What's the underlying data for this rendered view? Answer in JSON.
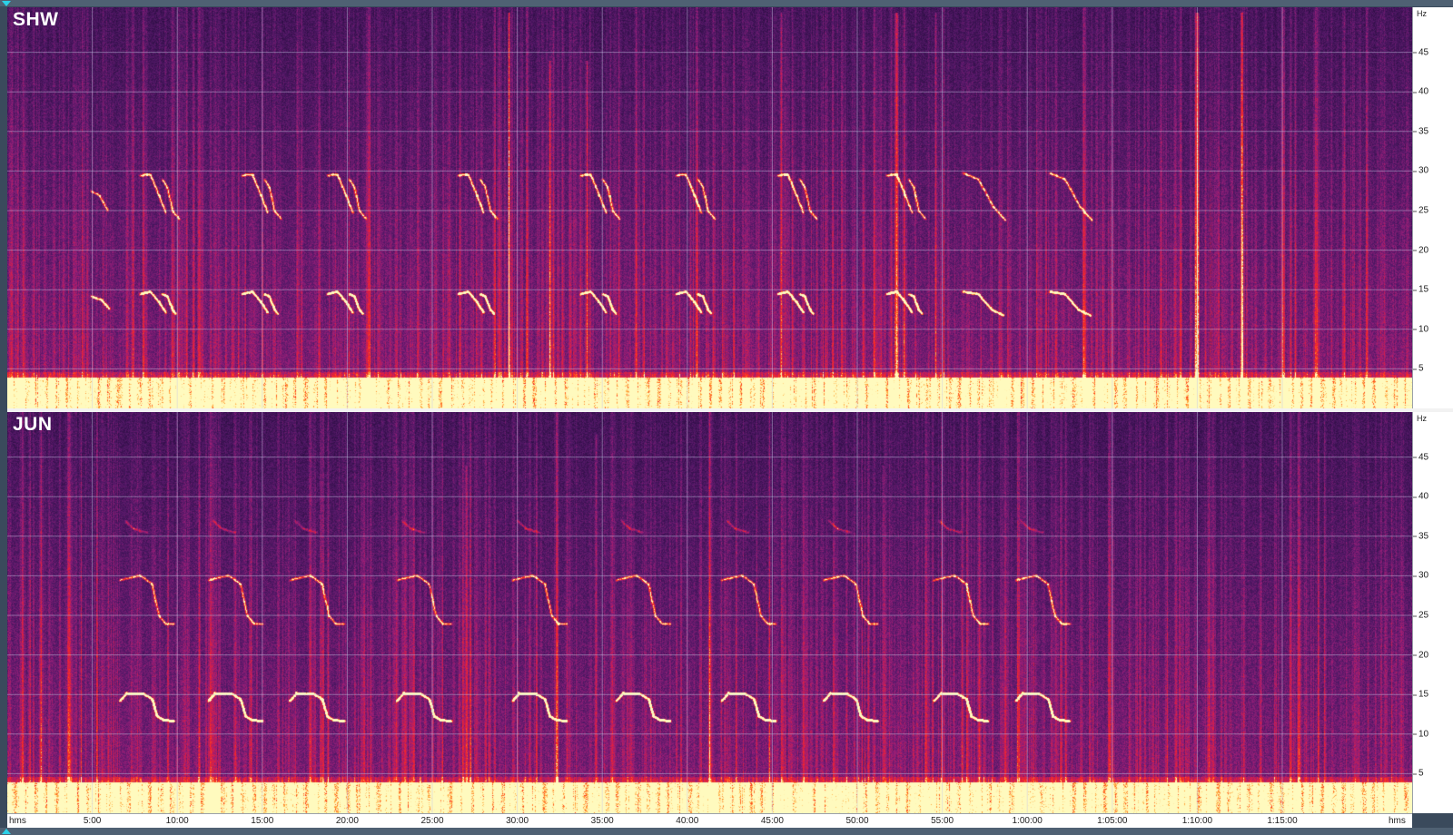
{
  "panes": [
    {
      "station": "SHW"
    },
    {
      "station": "JUN"
    }
  ],
  "frequency_axis": {
    "unit": "Hz",
    "ticks": [
      "5",
      "10",
      "15",
      "20",
      "25",
      "30",
      "35",
      "40",
      "45"
    ],
    "max_hz": 50
  },
  "time_axis": {
    "unit": "hms",
    "ticks": [
      "5:00",
      "10:00",
      "15:00",
      "20:00",
      "25:00",
      "30:00",
      "35:00",
      "40:00",
      "45:00",
      "50:00",
      "55:00",
      "1:00:00",
      "1:05:00",
      "1:10:00",
      "1:15:00"
    ],
    "total_minutes": 81
  },
  "colors": {
    "background_low": "#2a0f44",
    "mid": "#7a1e7c",
    "high": "#ff2a1a",
    "peak": "#fff3a0",
    "marker": "#2bd1e8"
  }
}
